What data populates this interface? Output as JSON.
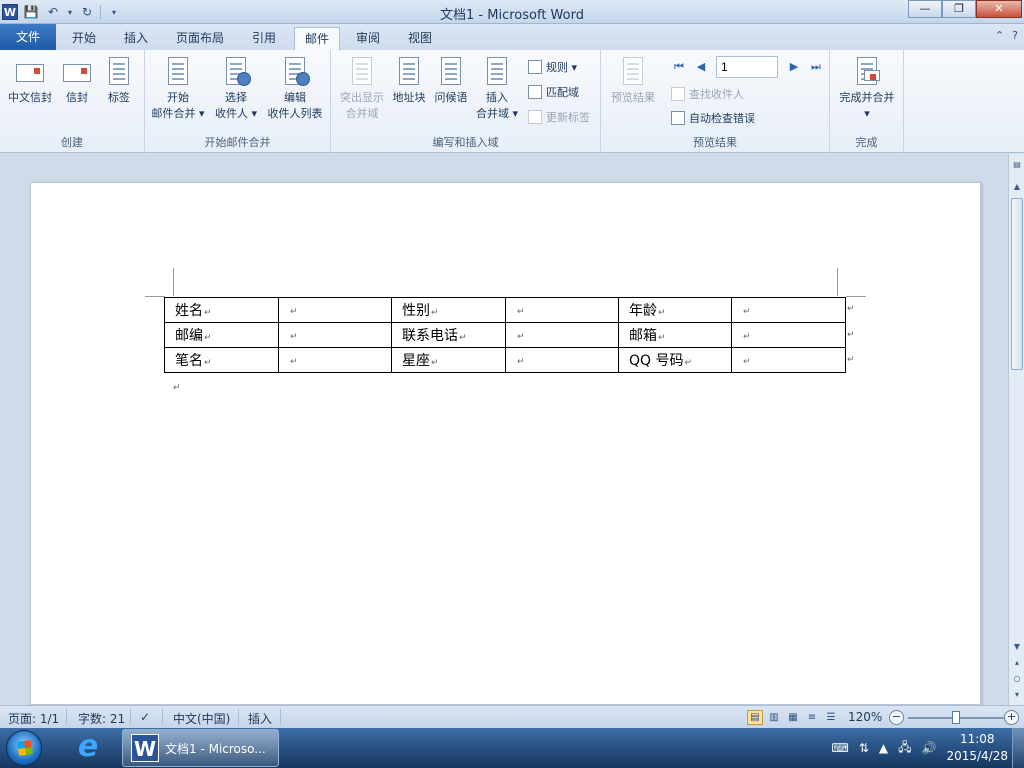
{
  "window": {
    "title": "文档1 - Microsoft Word",
    "app_logo": "W"
  },
  "tabs": [
    "文件",
    "开始",
    "插入",
    "页面布局",
    "引用",
    "邮件",
    "审阅",
    "视图"
  ],
  "ribbon": {
    "groups": {
      "create": "创建",
      "start_merge": "开始邮件合并",
      "write_insert": "编写和插入域",
      "preview": "预览结果",
      "finish": "完成"
    },
    "buttons": {
      "chinese_envelope": "中文信封",
      "envelope": "信封",
      "labels": "标签",
      "start_merge_l1": "开始",
      "start_merge_l2": "邮件合并 ▾",
      "select_l1": "选择",
      "select_l2": "收件人 ▾",
      "edit_l1": "编辑",
      "edit_l2": "收件人列表",
      "highlight_l1": "突出显示",
      "highlight_l2": "合并域",
      "address_block": "地址块",
      "greeting": "问候语",
      "insert_l1": "插入",
      "insert_l2": "合并域 ▾",
      "rules": "规则 ▾",
      "match_fields": "匹配域",
      "update_labels": "更新标签",
      "preview_results": "预览结果",
      "find_recipient": "查找收件人",
      "auto_check": "自动检查错误",
      "finish_merge": "完成并合并",
      "finish_arrow": "▾"
    },
    "record_number": "1"
  },
  "table": {
    "rows": [
      [
        "姓名",
        "",
        "性别",
        "",
        "年龄",
        ""
      ],
      [
        "邮编",
        "",
        "联系电话",
        "",
        "邮箱",
        ""
      ],
      [
        "笔名",
        "",
        "星座",
        "",
        "QQ 号码",
        ""
      ]
    ]
  },
  "status": {
    "page": "页面: 1/1",
    "words": "字数: 21",
    "language": "中文(中国)",
    "mode": "插入",
    "zoom": "120%",
    "zoom_level": 0.5
  },
  "taskbar": {
    "task_label": "文档1 - Microso...",
    "time": "11:08",
    "date": "2015/4/28"
  }
}
